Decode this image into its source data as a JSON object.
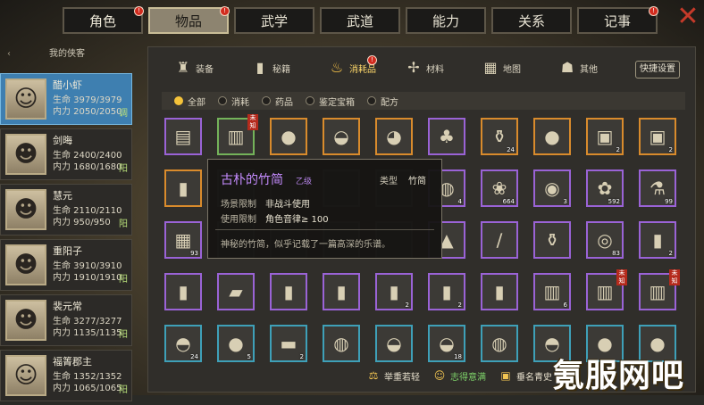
{
  "tabs": [
    {
      "label": "角色",
      "badge": true,
      "active": false
    },
    {
      "label": "物品",
      "badge": true,
      "active": true
    },
    {
      "label": "武学",
      "badge": false,
      "active": false
    },
    {
      "label": "武道",
      "badge": false,
      "active": false
    },
    {
      "label": "能力",
      "badge": false,
      "active": false
    },
    {
      "label": "关系",
      "badge": false,
      "active": false
    },
    {
      "label": "记事",
      "badge": true,
      "active": false
    }
  ],
  "close_icon": "✕",
  "left_title": "我的侠客",
  "characters": [
    {
      "name": "醋小虾",
      "hp": "生命 3979/3979",
      "mp": "内力 2050/2050",
      "tag": "调",
      "icon": "☺",
      "selected": true
    },
    {
      "name": "剑晦",
      "hp": "生命 2400/2400",
      "mp": "内力 1680/1680",
      "tag": "阳",
      "icon": "☻",
      "selected": false
    },
    {
      "name": "慧元",
      "hp": "生命 2110/2110",
      "mp": "内力 950/950",
      "tag": "阳",
      "icon": "☻",
      "selected": false
    },
    {
      "name": "重阳子",
      "hp": "生命 3910/3910",
      "mp": "内力 1910/1910",
      "tag": "阳",
      "icon": "☻",
      "selected": false
    },
    {
      "name": "裴元常",
      "hp": "生命 3277/3277",
      "mp": "内力 1135/1135",
      "tag": "阳",
      "icon": "☻",
      "selected": false
    },
    {
      "name": "福箐郡主",
      "hp": "生命 1352/1352",
      "mp": "内力 1065/1065",
      "tag": "阳",
      "icon": "☺",
      "selected": false
    }
  ],
  "categories": [
    {
      "label": "装备",
      "icon": "♜",
      "active": false,
      "badge": false
    },
    {
      "label": "秘籍",
      "icon": "▮",
      "active": false,
      "badge": false
    },
    {
      "label": "消耗品",
      "icon": "♨",
      "active": true,
      "badge": true
    },
    {
      "label": "材料",
      "icon": "✢",
      "active": false,
      "badge": false
    },
    {
      "label": "地图",
      "icon": "▦",
      "active": false,
      "badge": false
    },
    {
      "label": "其他",
      "icon": "☗",
      "active": false,
      "badge": false
    }
  ],
  "quick_setup": "快捷设置",
  "filters": [
    {
      "label": "全部",
      "on": true,
      "badge": true
    },
    {
      "label": "消耗",
      "on": false,
      "badge": false
    },
    {
      "label": "药品",
      "on": false,
      "badge": false
    },
    {
      "label": "鉴定宝箱",
      "on": false,
      "badge": true
    },
    {
      "label": "配方",
      "on": false,
      "badge": false
    }
  ],
  "items": [
    {
      "icon": "▤",
      "color": "purple",
      "qty": "",
      "unknown": false
    },
    {
      "icon": "▥",
      "color": "green",
      "qty": "",
      "unknown": true
    },
    {
      "icon": "●",
      "color": "orange",
      "qty": "",
      "unknown": false
    },
    {
      "icon": "◒",
      "color": "orange",
      "qty": "",
      "unknown": false
    },
    {
      "icon": "◕",
      "color": "orange",
      "qty": "",
      "unknown": false
    },
    {
      "icon": "♣",
      "color": "purple",
      "qty": "",
      "unknown": false
    },
    {
      "icon": "⚱",
      "color": "orange",
      "qty": "24",
      "unknown": false
    },
    {
      "icon": "●",
      "color": "orange",
      "qty": "",
      "unknown": false
    },
    {
      "icon": "▣",
      "color": "orange",
      "qty": "2",
      "unknown": false
    },
    {
      "icon": "▣",
      "color": "orange",
      "qty": "2",
      "unknown": false
    },
    {
      "icon": "▮",
      "color": "orange",
      "qty": "",
      "unknown": false
    },
    {
      "icon": "",
      "color": "gray",
      "qty": "",
      "unknown": false
    },
    {
      "icon": "",
      "color": "gray",
      "qty": "",
      "unknown": false
    },
    {
      "icon": "",
      "color": "gray",
      "qty": "",
      "unknown": false
    },
    {
      "icon": "",
      "color": "gray",
      "qty": "",
      "unknown": false
    },
    {
      "icon": "◍",
      "color": "purple",
      "qty": "4",
      "unknown": false
    },
    {
      "icon": "❀",
      "color": "purple",
      "qty": "664",
      "unknown": false
    },
    {
      "icon": "◉",
      "color": "purple",
      "qty": "3",
      "unknown": false
    },
    {
      "icon": "✿",
      "color": "purple",
      "qty": "592",
      "unknown": false
    },
    {
      "icon": "⚗",
      "color": "purple",
      "qty": "99",
      "unknown": false
    },
    {
      "icon": "▦",
      "color": "purple",
      "qty": "93",
      "unknown": false
    },
    {
      "icon": "",
      "color": "gray",
      "qty": "",
      "unknown": false
    },
    {
      "icon": "",
      "color": "gray",
      "qty": "",
      "unknown": false
    },
    {
      "icon": "",
      "color": "gray",
      "qty": "",
      "unknown": false
    },
    {
      "icon": "",
      "color": "gray",
      "qty": "",
      "unknown": false
    },
    {
      "icon": "▲",
      "color": "purple",
      "qty": "",
      "unknown": false
    },
    {
      "icon": "∕",
      "color": "purple",
      "qty": "",
      "unknown": false
    },
    {
      "icon": "⚱",
      "color": "purple",
      "qty": "",
      "unknown": false
    },
    {
      "icon": "◎",
      "color": "purple",
      "qty": "83",
      "unknown": false
    },
    {
      "icon": "▮",
      "color": "purple",
      "qty": "2",
      "unknown": false
    },
    {
      "icon": "▮",
      "color": "purple",
      "qty": "",
      "unknown": false
    },
    {
      "icon": "▰",
      "color": "purple",
      "qty": "",
      "unknown": false
    },
    {
      "icon": "▮",
      "color": "purple",
      "qty": "",
      "unknown": false
    },
    {
      "icon": "▮",
      "color": "purple",
      "qty": "",
      "unknown": false
    },
    {
      "icon": "▮",
      "color": "purple",
      "qty": "2",
      "unknown": false
    },
    {
      "icon": "▮",
      "color": "purple",
      "qty": "2",
      "unknown": false
    },
    {
      "icon": "▮",
      "color": "purple",
      "qty": "",
      "unknown": false
    },
    {
      "icon": "▥",
      "color": "purple",
      "qty": "6",
      "unknown": false
    },
    {
      "icon": "▥",
      "color": "purple",
      "qty": "",
      "unknown": true
    },
    {
      "icon": "▥",
      "color": "purple",
      "qty": "",
      "unknown": true
    },
    {
      "icon": "◓",
      "color": "cyan",
      "qty": "24",
      "unknown": false
    },
    {
      "icon": "●",
      "color": "cyan",
      "qty": "5",
      "unknown": false
    },
    {
      "icon": "▬",
      "color": "cyan",
      "qty": "2",
      "unknown": false
    },
    {
      "icon": "◍",
      "color": "cyan",
      "qty": "",
      "unknown": false
    },
    {
      "icon": "◒",
      "color": "cyan",
      "qty": "",
      "unknown": false
    },
    {
      "icon": "◒",
      "color": "cyan",
      "qty": "18",
      "unknown": false
    },
    {
      "icon": "◍",
      "color": "cyan",
      "qty": "",
      "unknown": false
    },
    {
      "icon": "◓",
      "color": "cyan",
      "qty": "",
      "unknown": false
    },
    {
      "icon": "●",
      "color": "cyan",
      "qty": "",
      "unknown": false
    },
    {
      "icon": "●",
      "color": "cyan",
      "qty": "",
      "unknown": false
    }
  ],
  "tooltip": {
    "name": "古朴的竹简",
    "grade": "乙级",
    "type_label": "类型",
    "type_value": "竹简",
    "scene_label": "场景限制",
    "scene_value": "非战斗使用",
    "use_label": "使用限制",
    "use_value": "角色音律≥ 100",
    "desc": "神秘的竹简，似乎记载了一篇高深的乐谱。"
  },
  "bottom": [
    {
      "label": "举重若轻",
      "icon": "⚖",
      "green": false
    },
    {
      "label": "志得意满",
      "icon": "☺",
      "green": true
    },
    {
      "label": "垂名青史",
      "icon": "▣",
      "green": false
    }
  ],
  "watermark": "氪服网吧"
}
